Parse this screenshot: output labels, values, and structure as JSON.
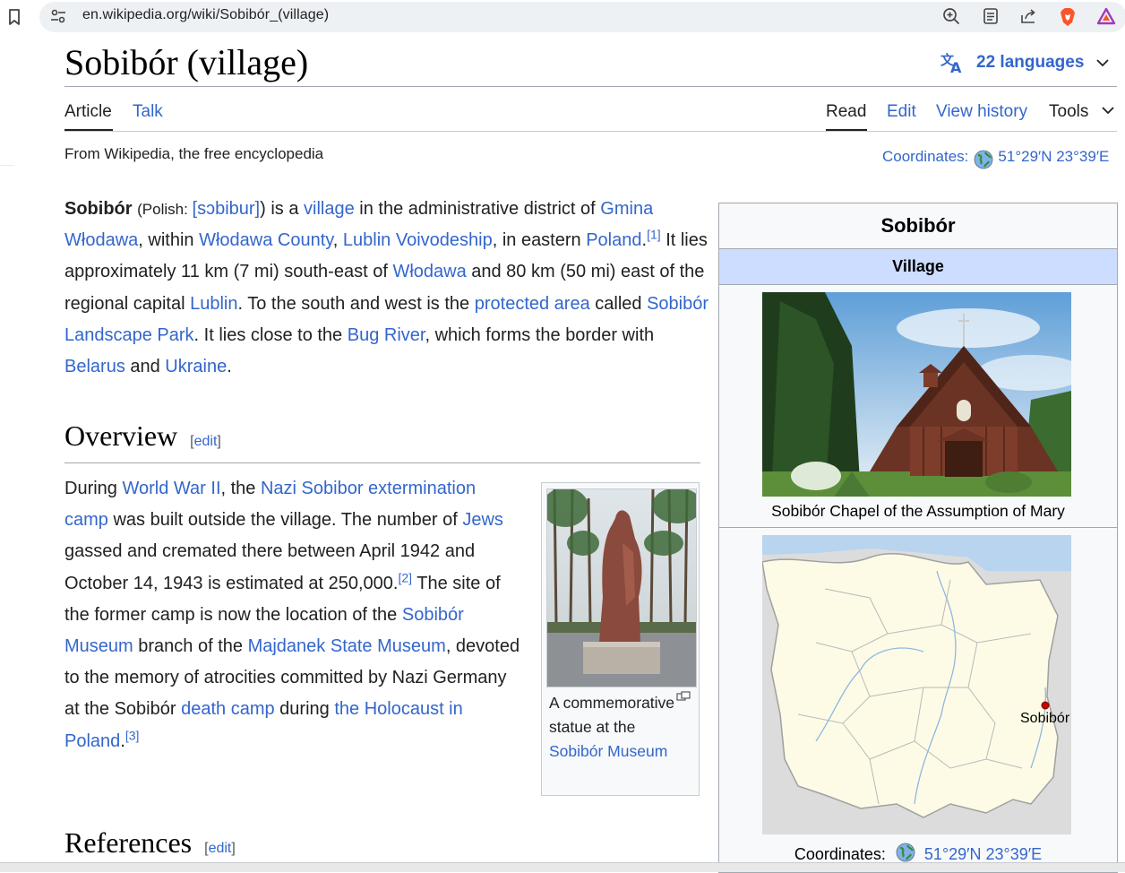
{
  "browser": {
    "url": "en.wikipedia.org/wiki/Sobibór_(village)"
  },
  "header": {
    "title": "Sobibór (village)",
    "languages": "22 languages",
    "tabs": {
      "article": "Article",
      "talk": "Talk",
      "read": "Read",
      "edit": "Edit",
      "history": "View history",
      "tools": "Tools"
    },
    "tagline": "From Wikipedia, the free encyclopedia",
    "coords_label": "Coordinates",
    "coords_value": "51°29′N 23°39′E"
  },
  "intro": {
    "bold": "Sobibór",
    "polish": "(Polish: ",
    "ipa": "[sɔbibur]",
    "t1": ") is a ",
    "l_village": "village",
    "t2": " in the administrative district of ",
    "l_gmina": "Gmina Włodawa",
    "t3": ", within ",
    "l_county": "Włodawa County",
    "t4": ", ",
    "l_voiv": "Lublin Voivodeship",
    "t5": ", in eastern ",
    "l_poland": "Poland",
    "t6": ".",
    "ref1": "[1]",
    "t7": " It lies approximately 11 km (7 mi) south-east of ",
    "l_wlodawa": "Włodawa",
    "t8": " and 80 km (50 mi) east of the regional capital ",
    "l_lublin": "Lublin",
    "t9": ". To the south and west is the ",
    "l_protected": "protected area",
    "t10": " called ",
    "l_park": "Sobibór Landscape Park",
    "t11": ". It lies close to the ",
    "l_bug": "Bug River",
    "t12": ", which forms the border with ",
    "l_belarus": "Belarus",
    "t13": " and ",
    "l_ukraine": "Ukraine",
    "t14": "."
  },
  "overview": {
    "heading": "Overview",
    "edit_open": "[",
    "edit_label": "edit",
    "edit_close": "]",
    "t1": "During ",
    "l_ww2": "World War II",
    "t2": ", the ",
    "l_camp": "Nazi Sobibor extermination camp",
    "t3": " was built outside the village. The number of ",
    "l_jews": "Jews",
    "t4": " gassed and cremated there between April 1942 and October 14, 1943 is estimated at 250,000.",
    "ref2": "[2]",
    "t5": " The site of the former camp is now the location of the ",
    "l_museum": "Sobibór Museum",
    "t6": " branch of the ",
    "l_majdanek": "Majdanek State Museum",
    "t7": ", devoted to the memory of atrocities committed by Nazi Germany at the Sobibór ",
    "l_deathcamp": "death camp",
    "t8": " during ",
    "l_holocaust": "the Holocaust in Poland",
    "t9": ".",
    "ref3": "[3]"
  },
  "thumb": {
    "caption": "A commemorative statue at the ",
    "caption_link": "Sobibór Museum"
  },
  "references": {
    "heading": "References",
    "edit_label": "edit"
  },
  "infobox": {
    "title": "Sobibór",
    "type": "Village",
    "photo_caption": "Sobibór Chapel of the Assumption of Mary",
    "map_label": "Sobibór",
    "coords_label": "Coordinates",
    "coords_value": "51°29′N 23°39′E"
  },
  "colors": {
    "link": "#3366cc",
    "infobox_header": "#ccddff",
    "text": "#202122"
  }
}
